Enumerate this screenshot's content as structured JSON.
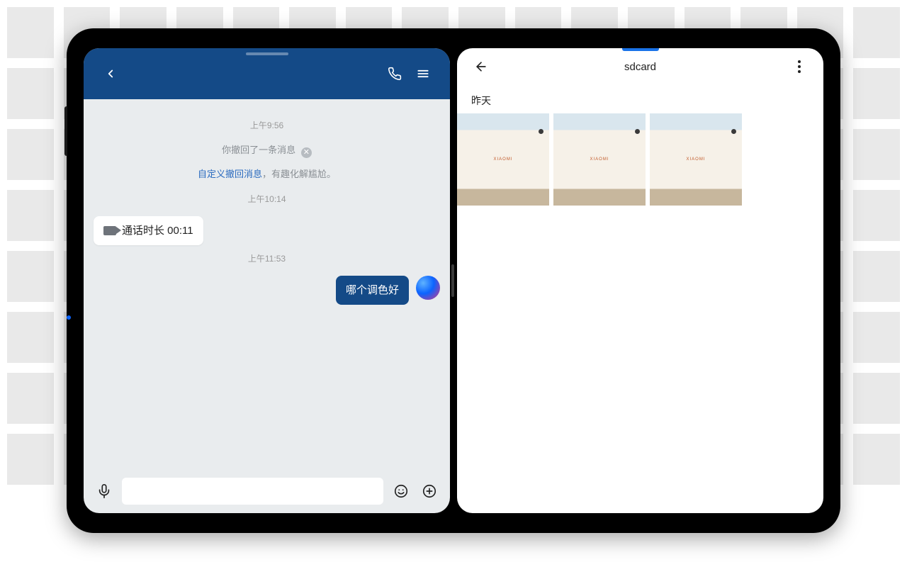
{
  "chat": {
    "timestamps": {
      "t1": "上午9:56",
      "t2": "上午10:14",
      "t3": "上午11:53"
    },
    "recall_notice": "你撤回了一条消息",
    "recall_link": "自定义撤回消息",
    "recall_tail": "，有趣化解尴尬。",
    "call_log": "通话时长 00:11",
    "outgoing": "哪个调色好",
    "input_placeholder": ""
  },
  "gallery": {
    "title": "sdcard",
    "section": "昨天",
    "thumb_label": "XIAOMI"
  }
}
